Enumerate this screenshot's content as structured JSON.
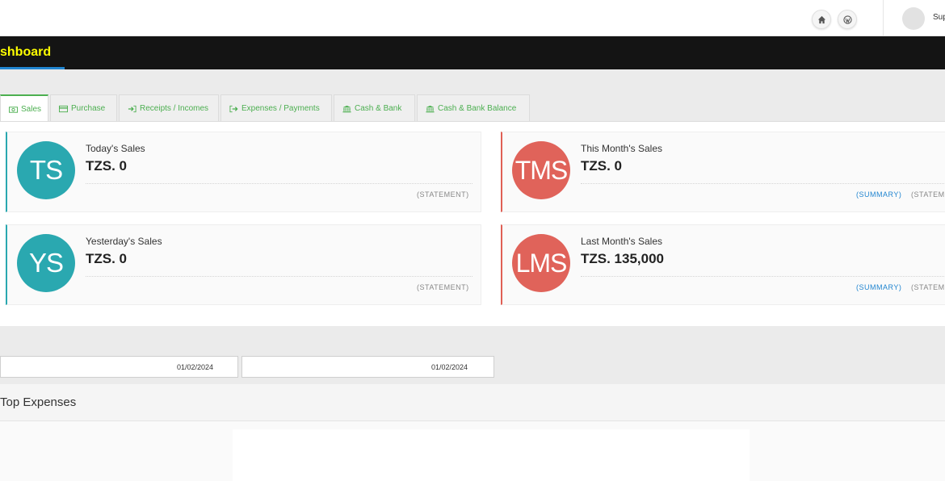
{
  "topbar": {
    "icons": [
      "home-icon",
      "wordpress-icon"
    ],
    "username": "Sup"
  },
  "header": {
    "title": "shboard"
  },
  "tabs": [
    {
      "label": "Sales",
      "icon": "money-icon",
      "active": true
    },
    {
      "label": "Purchase",
      "icon": "credit-card-icon",
      "active": false
    },
    {
      "label": "Receipts / Incomes",
      "icon": "sign-in-icon",
      "active": false
    },
    {
      "label": "Expenses / Payments",
      "icon": "sign-out-icon",
      "active": false
    },
    {
      "label": "Cash & Bank",
      "icon": "bank-icon",
      "active": false
    },
    {
      "label": "Cash & Bank Balance",
      "icon": "bank-icon",
      "active": false
    }
  ],
  "cards": {
    "today": {
      "initials": "TS",
      "label": "Today's Sales",
      "value": "TZS. 0",
      "statement": "(STATEMENT)"
    },
    "month": {
      "initials": "TMS",
      "label": "This Month's Sales",
      "value": "TZS. 0",
      "summary": "(SUMMARY)",
      "statement": "(STATEM"
    },
    "yesterday": {
      "initials": "YS",
      "label": "Yesterday's Sales",
      "value": "TZS. 0",
      "statement": "(STATEMENT)"
    },
    "last_month": {
      "initials": "LMS",
      "label": "Last Month's Sales",
      "value": "TZS. 135,000",
      "summary": "(SUMMARY)",
      "statement": "(STATEM"
    }
  },
  "filters": {
    "from_date": "01/02/2024",
    "to_date": "01/02/2024"
  },
  "expenses": {
    "title": "Top Expenses"
  },
  "colors": {
    "title_text": "#ffff00",
    "tab_text": "#4caf50",
    "teal": "#2aa8b0",
    "red": "#e0635a",
    "link_blue": "#2185d0"
  }
}
